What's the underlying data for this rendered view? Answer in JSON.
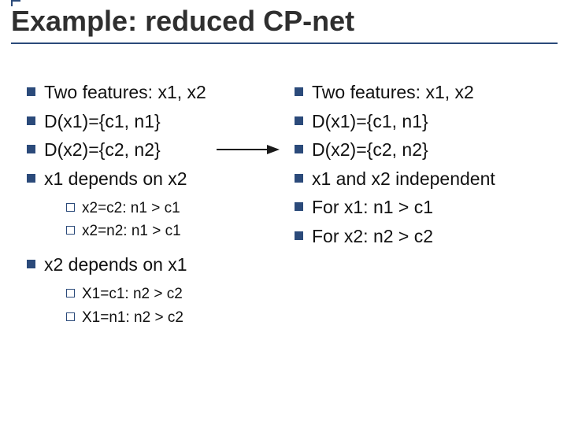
{
  "title": "Example: reduced CP-net",
  "left": {
    "b1": "Two features: x1, x2",
    "b2": "D(x1)={c1, n1}",
    "b3": "D(x2)={c2, n2}",
    "b4": "x1 depends on x2",
    "b4s1": "x2=c2: n1 > c1",
    "b4s2": "x2=n2: n1 > c1",
    "b5": "x2 depends on x1",
    "b5s1": "X1=c1: n2 > c2",
    "b5s2": "X1=n1: n2 > c2"
  },
  "right": {
    "b1": "Two features: x1, x2",
    "b2": "D(x1)={c1, n1}",
    "b3": "D(x2)={c2, n2}",
    "b4": "x1 and x2 independent",
    "b5": "For x1: n1 > c1",
    "b6": "For x2: n2 > c2"
  }
}
